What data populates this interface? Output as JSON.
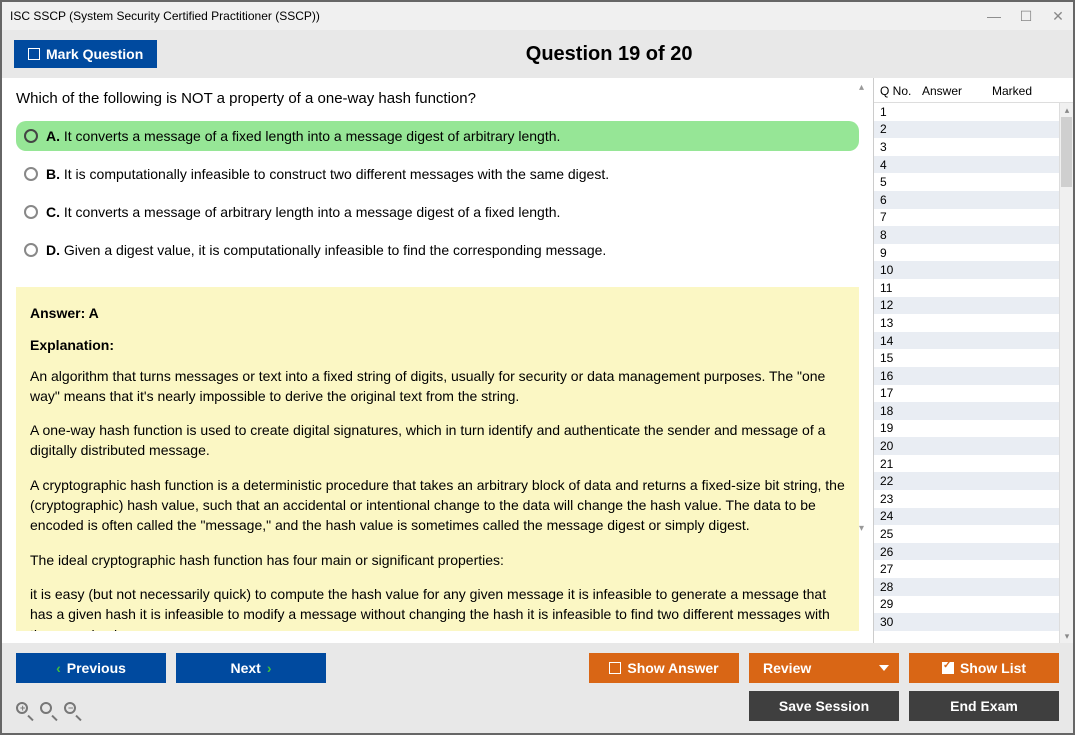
{
  "window": {
    "title": "ISC SSCP (System Security Certified Practitioner (SSCP))"
  },
  "header": {
    "mark_label": "Mark Question",
    "question_title": "Question 19 of 20"
  },
  "question": {
    "prompt": "Which of the following is NOT a property of a one-way hash function?",
    "options": [
      {
        "letter": "A.",
        "text": "It converts a message of a fixed length into a message digest of arbitrary length.",
        "selected": true
      },
      {
        "letter": "B.",
        "text": "It is computationally infeasible to construct two different messages with the same digest.",
        "selected": false
      },
      {
        "letter": "C.",
        "text": "It converts a message of arbitrary length into a message digest of a fixed length.",
        "selected": false
      },
      {
        "letter": "D.",
        "text": "Given a digest value, it is computationally infeasible to find the corresponding message.",
        "selected": false
      }
    ]
  },
  "answer": {
    "title": "Answer: A",
    "explanation_label": "Explanation:",
    "paragraphs": [
      "An algorithm that turns messages or text into a fixed string of digits, usually for security or data management purposes. The \"one way\" means that it's nearly impossible to derive the original text from the string.",
      "A one-way hash function is used to create digital signatures, which in turn identify and authenticate the sender and message of a digitally distributed message.",
      "A cryptographic hash function is a deterministic procedure that takes an arbitrary block of data and returns a fixed-size bit string, the (cryptographic) hash value, such that an accidental or intentional change to the data will change the hash value. The data to be encoded is often called the \"message,\" and the hash value is sometimes called the message digest or simply digest.",
      "The ideal cryptographic hash function has four main or significant properties:",
      "it is easy (but not necessarily quick) to compute the hash value for any given message it is infeasible to generate a message that has a given hash it is infeasible to modify a message without changing the hash it is infeasible to find two different messages with the same hash"
    ]
  },
  "sidebar": {
    "cols": {
      "qno": "Q No.",
      "answer": "Answer",
      "marked": "Marked"
    },
    "count": 30
  },
  "buttons": {
    "previous": "Previous",
    "next": "Next",
    "show_answer": "Show Answer",
    "review": "Review",
    "show_list": "Show List",
    "save_session": "Save Session",
    "end_exam": "End Exam"
  }
}
